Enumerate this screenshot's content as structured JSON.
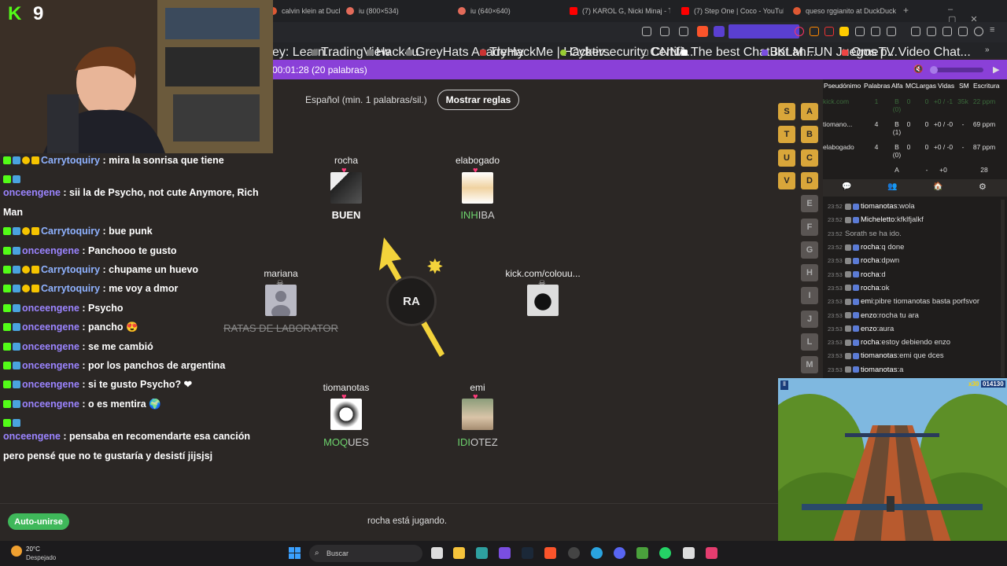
{
  "browser": {
    "tabs": [
      {
        "label": "calvin klein at Duck",
        "color": "#de5833"
      },
      {
        "label": "iu (800×534)",
        "color": "#e36b5a"
      },
      {
        "label": "iu (640×640)",
        "color": "#e36b5a"
      },
      {
        "label": "(7) KAROL G, Nicki Minaj - Tusa",
        "color": "#ff0000"
      },
      {
        "label": "(7) Step One | Coco - YouTube",
        "color": "#ff0000"
      },
      {
        "label": "queso rggianito at DuckDuck",
        "color": "#de5833"
      }
    ],
    "bookmarks": [
      "ey: Learn...",
      "TradingView",
      "Hack4u",
      "GreyHats Academy",
      "TryHackMe | Hacktiv...",
      "Cybersecurity Certifi...",
      "CNNA",
      "The best ChatBot an...",
      "JKLM.FUN Juegos p...",
      "OmeTV Video Chat..."
    ]
  },
  "game": {
    "timer": "00:01:28 (20 palabras)",
    "language": "Español (min. 1 palabras/sil.)",
    "rules_button": "Mostrar reglas",
    "syllable": "RA",
    "players": [
      {
        "name": "rocha",
        "word": "BUEN",
        "word_color": "#ffffff",
        "heart": "♥"
      },
      {
        "name": "elabogado",
        "word_hl": "INH",
        "word_rest": "IBA",
        "heart": "♥"
      },
      {
        "name": "mariana",
        "word": "RATAS DE LABORATOR",
        "dead": "☠"
      },
      {
        "name": "kick.com/colouu...",
        "word": "",
        "dead": "☠"
      },
      {
        "name": "tiomanotas",
        "word_hl": "MOQ",
        "word_rest": "UES",
        "heart": "♥"
      },
      {
        "name": "emi",
        "word_hl": "IDI",
        "word_rest": "OTEZ",
        "heart": "♥"
      }
    ],
    "auto_join": "Auto-unirse",
    "status": "rocha está jugando.",
    "letters": [
      "S",
      "T",
      "U",
      "V",
      "A",
      "B",
      "C",
      "D",
      "E",
      "F",
      "G",
      "H",
      "I",
      "J",
      "L",
      "M"
    ],
    "letters_on": [
      "S",
      "T",
      "U",
      "V",
      "A",
      "B",
      "C",
      "D"
    ]
  },
  "scoreboard": {
    "headers": [
      "Pseudónimo",
      "Palabras",
      "Alfa",
      "MC",
      "Largas",
      "Vidas",
      "SM",
      "Escritura"
    ],
    "rows": [
      {
        "name": "kick.com",
        "palabras": "1",
        "alfa": "B (0)",
        "mc": "0",
        "largas": "0",
        "vidas": "+0 / -1",
        "sm": "35k",
        "escritura": "22 ppm"
      },
      {
        "name": "tiomano...",
        "palabras": "4",
        "alfa": "B (1)",
        "mc": "0",
        "largas": "0",
        "vidas": "+0 / -0",
        "sm": "-",
        "escritura": "69 ppm"
      },
      {
        "name": "elabogado",
        "palabras": "4",
        "alfa": "B (0)",
        "mc": "0",
        "largas": "0",
        "vidas": "+0 / -0",
        "sm": "-",
        "escritura": "87 ppm"
      },
      {
        "name": "",
        "palabras": "",
        "alfa": "A",
        "mc": "",
        "largas": "-",
        "vidas": "+0",
        "sm": "",
        "escritura": "28"
      }
    ]
  },
  "game_chat": [
    {
      "time": "23:52",
      "user": "tiomanotas",
      "text": "wola"
    },
    {
      "time": "23:52",
      "user": "Micheletto",
      "text": "kfklfjalkf"
    },
    {
      "time": "23:52",
      "user": "",
      "text": "Sorath se ha ido."
    },
    {
      "time": "23:52",
      "user": "rocha",
      "text": "q done"
    },
    {
      "time": "23:53",
      "user": "rocha",
      "text": "dpwn"
    },
    {
      "time": "23:53",
      "user": "rocha",
      "text": "d"
    },
    {
      "time": "23:53",
      "user": "rocha",
      "text": "ok"
    },
    {
      "time": "23:53",
      "user": "emi",
      "text": "pibre tiomanotas basta porfsvor"
    },
    {
      "time": "23:53",
      "user": "enzo",
      "text": "rocha tu ara"
    },
    {
      "time": "23:53",
      "user": "enzo",
      "text": "aura"
    },
    {
      "time": "23:53",
      "user": "rocha",
      "text": "estoy debiendo enzo"
    },
    {
      "time": "23:53",
      "user": "tiomanotas",
      "text": "emi  que dces"
    },
    {
      "time": "23:53",
      "user": "tiomanotas",
      "text": "a"
    }
  ],
  "stream": {
    "viewer_count": "9",
    "chat": [
      {
        "user": "Carrytoquiry",
        "text": "mira la sonrisa que tiene",
        "style": "u1",
        "badges": 3
      },
      {
        "user": "onceengene",
        "text": "sii la de Psycho, not cute Anymore, Rich Man",
        "style": "u2",
        "badges": 2
      },
      {
        "user": "Carrytoquiry",
        "text": "bue punk",
        "style": "u1",
        "badges": 3
      },
      {
        "user": "onceengene",
        "text": "Panchooo te gusto",
        "style": "u2",
        "badges": 2
      },
      {
        "user": "Carrytoquiry",
        "text": "chupame un huevo",
        "style": "u1",
        "badges": 3
      },
      {
        "user": "Carrytoquiry",
        "text": "me voy a dmor",
        "style": "u1",
        "badges": 3
      },
      {
        "user": "onceengene",
        "text": "Psycho",
        "style": "u2",
        "badges": 2
      },
      {
        "user": "onceengene",
        "text": "pancho 😍",
        "style": "u2",
        "badges": 2
      },
      {
        "user": "onceengene",
        "text": "se me cambió",
        "style": "u2",
        "badges": 2
      },
      {
        "user": "onceengene",
        "text": "por los panchos de argentina",
        "style": "u2",
        "badges": 2
      },
      {
        "user": "onceengene",
        "text": "si te gusto Psycho? ❤",
        "style": "u2",
        "badges": 2
      },
      {
        "user": "onceengene",
        "text": "o es mentira 🌍",
        "style": "u2",
        "badges": 2
      },
      {
        "user": "onceengene",
        "text": "pensaba en recomendarte esa canción pero pensé que no te gustaría y desistí jijsjsj",
        "style": "u2",
        "badges": 2
      }
    ]
  },
  "subway": {
    "score": "014130",
    "multiplier": "x30"
  },
  "taskbar": {
    "temp": "20°C",
    "weather": "Despejado",
    "search": "Buscar"
  },
  "colors": {
    "accent": "#8a40d8",
    "kick_green": "#53fc18",
    "letter_on": "#d9a63a",
    "hl_green": "#6dd36d"
  }
}
